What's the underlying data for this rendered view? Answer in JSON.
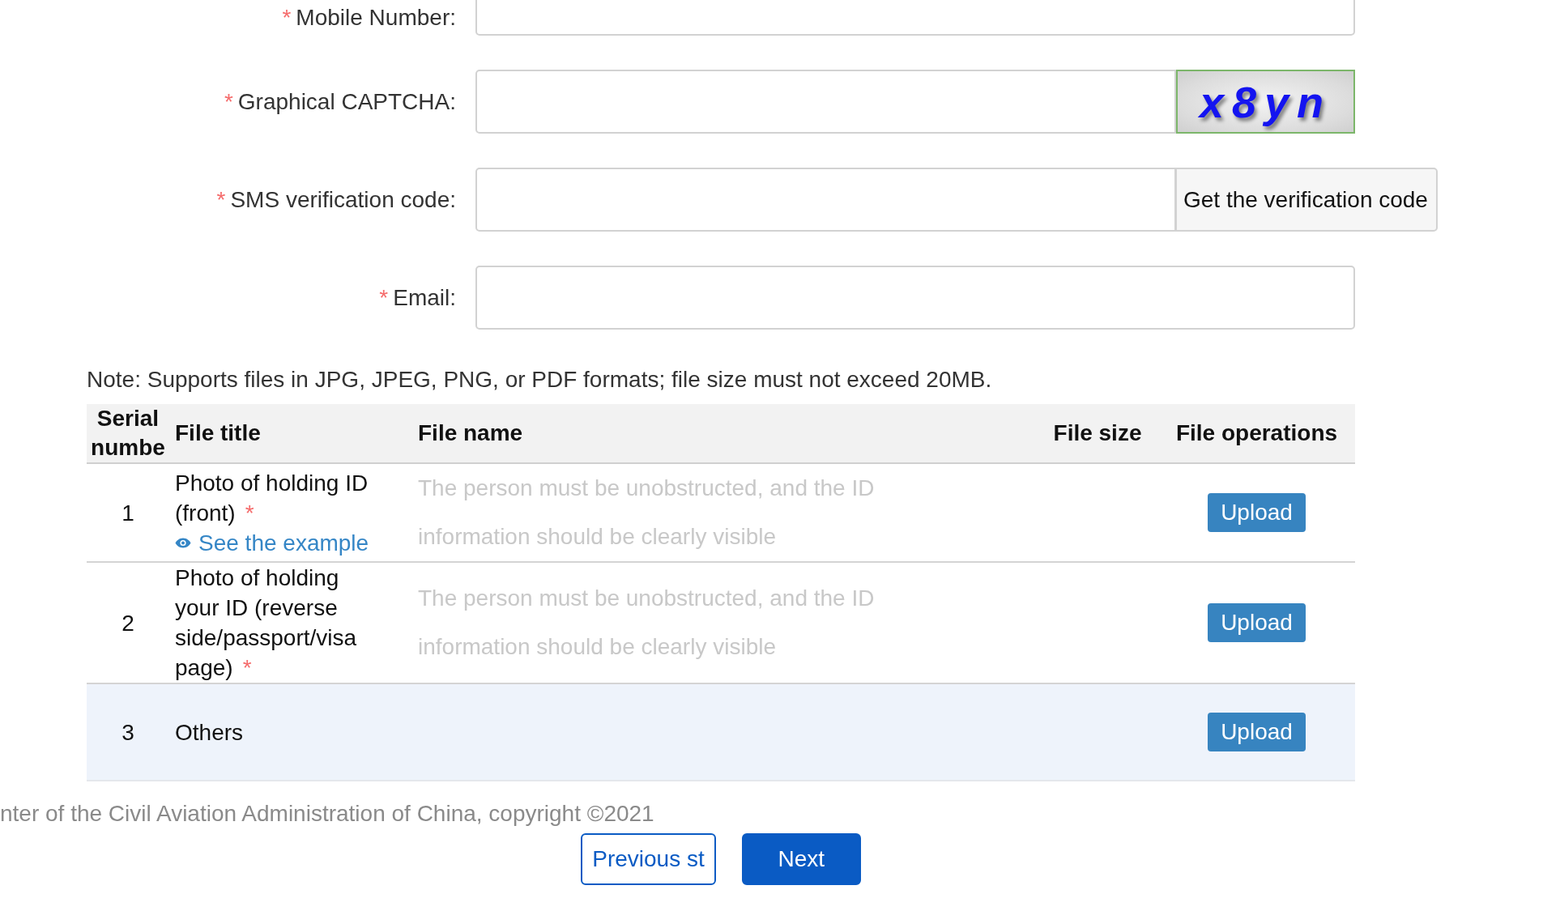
{
  "form": {
    "fields": [
      {
        "kind": "text",
        "required_mark": "*",
        "label": "Mobile Number:"
      },
      {
        "kind": "captcha",
        "required_mark": "*",
        "label": "Graphical CAPTCHA:",
        "captcha_text": "x8yn"
      },
      {
        "kind": "sms",
        "required_mark": "*",
        "label": "SMS verification code:",
        "button": "Get the verification code"
      },
      {
        "kind": "text",
        "required_mark": "*",
        "label": "Email:"
      }
    ]
  },
  "note": "Note: Supports files in JPG, JPEG, PNG, or PDF formats; file size must not exceed 20MB.",
  "file_table": {
    "columns": [
      "Serial numbe",
      "File title",
      "File name",
      "File size",
      "File operations"
    ],
    "rows": [
      {
        "serial": "1",
        "title": "Photo of holding ID (front)",
        "required_mark": "*",
        "example_link": "See the example",
        "file_name_hint": "The person must be unobstructed, and the ID information should be clearly visible",
        "action": "Upload",
        "highlighted": false
      },
      {
        "serial": "2",
        "title": "Photo of holding your ID (reverse side/passport/visa page)",
        "required_mark": "*",
        "file_name_hint": "The person must be unobstructed, and the ID information should be clearly visible",
        "action": "Upload",
        "highlighted": false
      },
      {
        "serial": "3",
        "title": "Others",
        "action": "Upload",
        "highlighted": true
      }
    ]
  },
  "footer": {
    "copyright": "nter of the Civil Aviation Administration of China, copyright ©2021"
  },
  "buttons": [
    {
      "kind": "secondary",
      "label": "Previous st"
    },
    {
      "kind": "primary",
      "label": "Next"
    }
  ]
}
